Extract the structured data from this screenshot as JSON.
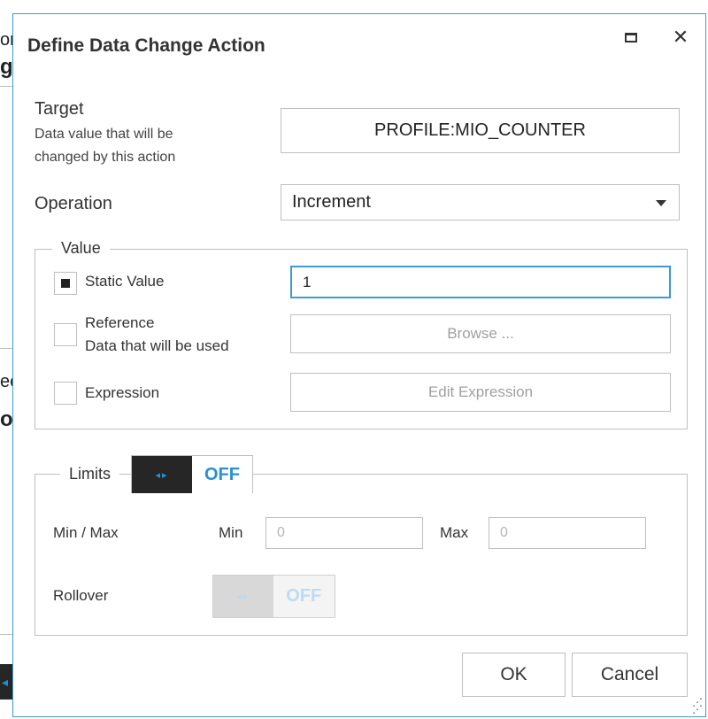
{
  "background": {
    "fragments": [
      "or",
      "g",
      "ee",
      "oc"
    ]
  },
  "dialog": {
    "title": "Define Data Change Action",
    "target": {
      "label": "Target",
      "description_line1": "Data value that will be",
      "description_line2": "changed by this action",
      "value": "PROFILE:MIO_COUNTER"
    },
    "operation": {
      "label": "Operation",
      "selected": "Increment"
    },
    "value_group": {
      "legend": "Value",
      "static_value": {
        "label": "Static Value",
        "checked": true,
        "value": "1"
      },
      "reference": {
        "label": "Reference",
        "sublabel": "Data that will be used",
        "checked": false,
        "button": "Browse ..."
      },
      "expression": {
        "label": "Expression",
        "checked": false,
        "button": "Edit Expression"
      }
    },
    "limits_group": {
      "legend": "Limits",
      "toggle_state": "OFF",
      "min_max": {
        "label": "Min / Max",
        "min_label": "Min",
        "min_placeholder": "0",
        "max_label": "Max",
        "max_placeholder": "0"
      },
      "rollover": {
        "label": "Rollover",
        "toggle_state": "OFF"
      }
    },
    "buttons": {
      "ok": "OK",
      "cancel": "Cancel"
    },
    "toggle_knob_glyph": "◂▸"
  },
  "colors": {
    "accent": "#3d9ad7",
    "toggle_dark": "#262626",
    "toggle_text": "#2a8fd4"
  }
}
